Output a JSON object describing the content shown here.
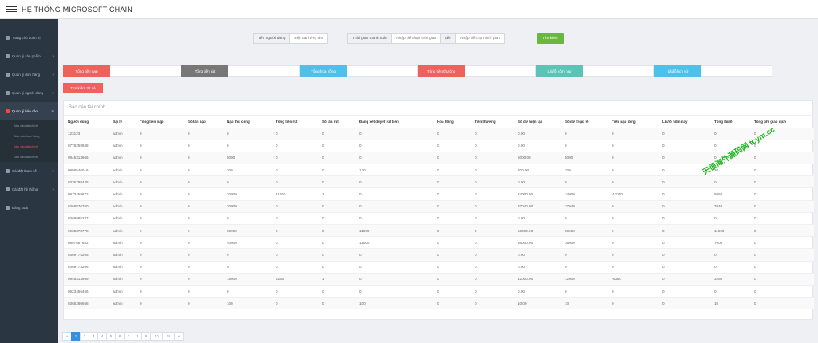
{
  "app": {
    "title": "HỆ THỐNG MICROSOFT CHAIN"
  },
  "sidebar": {
    "items": [
      {
        "label": "Trang chủ quản trị"
      },
      {
        "label": "Quản lý sản phẩm"
      },
      {
        "label": "Quản lý đơn hàng"
      },
      {
        "label": "Quản lý người dùng"
      },
      {
        "label": "Quản lý báo cáo"
      },
      {
        "label": "Cài đặt tham số"
      },
      {
        "label": "Cài đặt hệ thống"
      },
      {
        "label": "Đăng xuất"
      }
    ],
    "subitems": [
      {
        "label": "Báo cáo tài chính"
      },
      {
        "label": "Báo cáo hoa hồng"
      },
      {
        "label": "Báo cáo tài chính"
      },
      {
        "label": "Báo cáo tài chính"
      }
    ]
  },
  "filters": {
    "user": {
      "label": "Tên người dùng",
      "placeholder": "Biệt danh/Họ tên"
    },
    "time": {
      "label": "Thời gian thanh toán",
      "start_placeholder": "Nhập để chọn thời gian",
      "sep": "đến",
      "end_placeholder": "Nhập để chọn thời gian"
    },
    "search_button": "Tìm kiếm"
  },
  "summary": [
    {
      "label": "Tổng tiền nạp",
      "color": "#f0605c"
    },
    {
      "label": "Tổng tiền rút",
      "color": "#777777"
    },
    {
      "label": "Tổng hoa hồng",
      "color": "#4fc1e9"
    },
    {
      "label": "Tổng tiền thưởng",
      "color": "#f0605c"
    },
    {
      "label": "Lãi/lỗ hôm nay",
      "color": "#5bc4b7"
    },
    {
      "label": "Lãi/lỗ lịch sử",
      "color": "#4fc1e9"
    }
  ],
  "reset_button": "Tìm kiếm tất cả",
  "table": {
    "title": "Báo cáo tài chính",
    "headers": [
      "Người dùng",
      "Đại lý",
      "Tổng tiền nạp",
      "Số lần nạp",
      "Nạp thủ công",
      "Tổng tiền rút",
      "Số lần rút",
      "Đang xét duyệt rút tiền",
      "Hoa hồng",
      "Tiền thưởng",
      "Số dư hiện tại",
      "Số dư thực tế",
      "Tiền nạp ròng",
      "Lãi/lỗ hôm nay",
      "Tổng lãi/lỗ",
      "Tổng phí giao dịch"
    ],
    "rows": [
      [
        "123123",
        "admin",
        "0",
        "0",
        "0",
        "0",
        "0",
        "0",
        "0",
        "0",
        "0.00",
        "0",
        "0",
        "0",
        "0",
        "0"
      ],
      [
        "0778259848",
        "admin",
        "0",
        "0",
        "0",
        "0",
        "0",
        "0",
        "0",
        "0",
        "0.00",
        "0",
        "0",
        "0",
        "0",
        "0"
      ],
      [
        "0945313665",
        "admin",
        "0",
        "0",
        "5000",
        "0",
        "0",
        "0",
        "0",
        "0",
        "5000.00",
        "5000",
        "0",
        "0",
        "0",
        "0"
      ],
      [
        "0986546016",
        "admin",
        "0",
        "0",
        "300",
        "0",
        "0",
        "120",
        "0",
        "0",
        "200.00",
        "200",
        "0",
        "0",
        "20",
        "0"
      ],
      [
        "0336798425",
        "admin",
        "0",
        "0",
        "0",
        "0",
        "0",
        "0",
        "0",
        "0",
        "0.00",
        "0",
        "0",
        "0",
        "0",
        "0"
      ],
      [
        "0973459672",
        "admin",
        "0",
        "0",
        "30000",
        "11050",
        "1",
        "0",
        "0",
        "0",
        "24000.00",
        "24000",
        "-11050",
        "0",
        "5050",
        "0"
      ],
      [
        "0368876750",
        "admin",
        "0",
        "0",
        "30000",
        "0",
        "0",
        "0",
        "0",
        "0",
        "37040.00",
        "37040",
        "0",
        "0",
        "7040",
        "0"
      ],
      [
        "0369985247",
        "admin",
        "0",
        "0",
        "0",
        "0",
        "0",
        "0",
        "0",
        "0",
        "0.00",
        "0",
        "0",
        "0",
        "0",
        "0"
      ],
      [
        "0935878778",
        "admin",
        "0",
        "0",
        "50000",
        "0",
        "0",
        "11000",
        "0",
        "0",
        "50600.00",
        "50600",
        "0",
        "0",
        "11600",
        "0"
      ],
      [
        "0897657852",
        "admin",
        "0",
        "0",
        "40000",
        "0",
        "0",
        "11000",
        "0",
        "0",
        "36000.00",
        "36000",
        "0",
        "0",
        "7000",
        "0"
      ],
      [
        "0369774205",
        "admin",
        "0",
        "0",
        "0",
        "0",
        "0",
        "0",
        "0",
        "0",
        "0.00",
        "0",
        "0",
        "0",
        "0",
        "0"
      ],
      [
        "0369774206",
        "admin",
        "0",
        "0",
        "0",
        "0",
        "0",
        "0",
        "0",
        "0",
        "0.00",
        "0",
        "0",
        "0",
        "0",
        "0"
      ],
      [
        "0945313989",
        "admin",
        "0",
        "0",
        "15000",
        "6250",
        "1",
        "0",
        "0",
        "0",
        "12000.00",
        "12000",
        "-6250",
        "0",
        "3250",
        "0"
      ],
      [
        "0923456456",
        "admin",
        "0",
        "0",
        "0",
        "0",
        "0",
        "0",
        "0",
        "0",
        "0.00",
        "0",
        "0",
        "0",
        "0",
        "0"
      ],
      [
        "0365280668",
        "admin",
        "0",
        "0",
        "100",
        "0",
        "0",
        "100",
        "0",
        "0",
        "10.00",
        "10",
        "0",
        "0",
        "10",
        "0"
      ]
    ]
  },
  "pagination": {
    "prev": "«",
    "pages": [
      "1",
      "2",
      "3",
      "4",
      "5",
      "6",
      "7",
      "8",
      "9",
      "10",
      "11"
    ],
    "next": "»",
    "current": "1"
  },
  "watermark": "天很海外源码网 tcym.cc"
}
